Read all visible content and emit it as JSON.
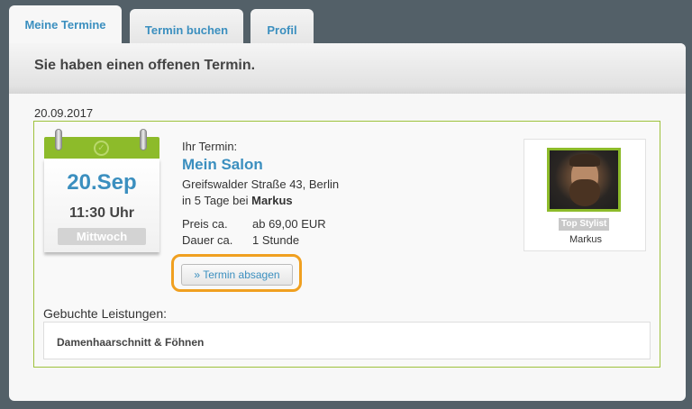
{
  "tabs": [
    {
      "label": "Meine Termine",
      "active": true
    },
    {
      "label": "Termin buchen",
      "active": false
    },
    {
      "label": "Profil",
      "active": false
    }
  ],
  "header": {
    "title": "Sie haben einen offenen Termin."
  },
  "appointment": {
    "date": "20.09.2017",
    "calendar": {
      "day": "20.Sep",
      "time": "11:30 Uhr",
      "weekday": "Mittwoch"
    },
    "label": "Ihr Termin:",
    "salon": "Mein Salon",
    "address": "Greifswalder Straße 43, Berlin",
    "in_days_prefix": "in 5 Tage bei",
    "stylist_bold": "Markus",
    "price_label": "Preis ca.",
    "price_value": "ab 69,00 EUR",
    "duration_label": "Dauer ca.",
    "duration_value": "1 Stunde",
    "cancel_button": "» Termin absagen"
  },
  "stylist": {
    "badge": "Top Stylist",
    "name": "Markus"
  },
  "services": {
    "label": "Gebuchte Leistungen:",
    "items": [
      "Damenhaarschnitt & Föhnen"
    ]
  },
  "colors": {
    "accent": "#3b8fbf",
    "green": "#8dbb2a",
    "highlight": "#f0a020",
    "background": "#536068"
  }
}
